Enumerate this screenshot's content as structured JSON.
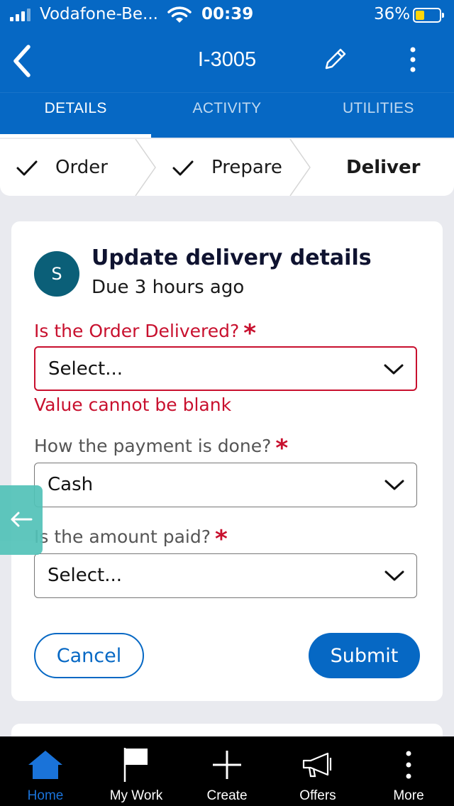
{
  "status_bar": {
    "carrier": "Vodafone-Be...",
    "time": "00:39",
    "battery_percent": "36%",
    "battery_level": 0.36
  },
  "header": {
    "title": "I-3005",
    "back_icon": "chevron-left-icon",
    "edit_icon": "pencil-icon",
    "menu_icon": "more-vertical-icon"
  },
  "tabs": [
    {
      "label": "DETAILS",
      "active": true
    },
    {
      "label": "ACTIVITY",
      "active": false
    },
    {
      "label": "UTILITIES",
      "active": false
    }
  ],
  "stepper": {
    "steps": [
      {
        "label": "Order",
        "status": "done"
      },
      {
        "label": "Prepare",
        "status": "done"
      },
      {
        "label": "Deliver",
        "status": "current"
      }
    ]
  },
  "task": {
    "avatar_initial": "S",
    "title": "Update delivery details",
    "due": "Due 3 hours ago"
  },
  "form": {
    "fields": [
      {
        "label": "Is the Order Delivered?",
        "required": true,
        "value": "Select...",
        "error": "Value cannot be blank"
      },
      {
        "label": "How the payment is done?",
        "required": true,
        "value": "Cash"
      },
      {
        "label": "Is the amount paid?",
        "required": true,
        "value": "Select..."
      }
    ],
    "required_marker": "*",
    "cancel_label": "Cancel",
    "submit_label": "Submit"
  },
  "bottom_nav": [
    {
      "label": "Home",
      "icon": "home-icon",
      "active": true
    },
    {
      "label": "My Work",
      "icon": "flag-icon",
      "active": false
    },
    {
      "label": "Create",
      "icon": "plus-icon",
      "active": false
    },
    {
      "label": "Offers",
      "icon": "megaphone-icon",
      "active": false
    },
    {
      "label": "More",
      "icon": "more-vertical-icon",
      "active": false
    }
  ],
  "colors": {
    "brand": "#0668c4",
    "error": "#c8102e",
    "avatar": "#0b5f78",
    "side_tab": "#52c2b8",
    "nav_active": "#1a73d9"
  }
}
